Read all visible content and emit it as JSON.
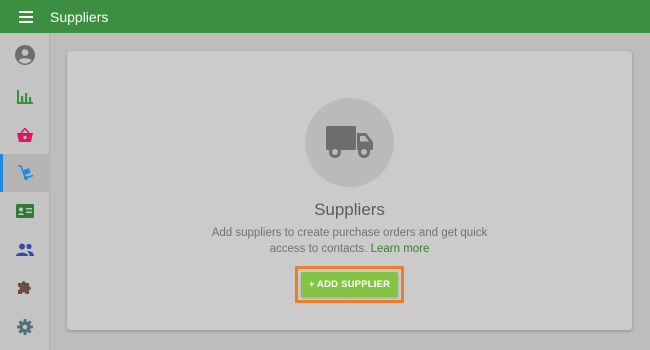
{
  "header": {
    "title": "Suppliers",
    "menu_icon": "hamburger-menu-icon"
  },
  "sidebar": {
    "items": [
      {
        "name": "account",
        "icon": "account-circle-icon",
        "color": "#6e6e6e"
      },
      {
        "name": "reports",
        "icon": "bar-chart-icon",
        "color": "#3c8f40"
      },
      {
        "name": "sales",
        "icon": "basket-icon",
        "color": "#d81b60"
      },
      {
        "name": "suppliers",
        "icon": "hand-truck-icon",
        "color": "#1e88e5",
        "active": true
      },
      {
        "name": "employees",
        "icon": "id-card-icon",
        "color": "#2e7d32"
      },
      {
        "name": "customers",
        "icon": "people-icon",
        "color": "#3949ab"
      },
      {
        "name": "integrations",
        "icon": "puzzle-icon",
        "color": "#6d4c41"
      },
      {
        "name": "settings",
        "icon": "gear-icon",
        "color": "#546e7a"
      }
    ]
  },
  "empty_state": {
    "icon": "truck-icon",
    "title": "Suppliers",
    "description": "Add suppliers to create purchase orders and get quick access to contacts.",
    "learn_more": "Learn more",
    "add_button": "+ ADD SUPPLIER"
  },
  "colors": {
    "topbar": "#3c8f40",
    "accent": "#84c444",
    "highlight": "#f07c25",
    "link": "#3a7f2e"
  }
}
